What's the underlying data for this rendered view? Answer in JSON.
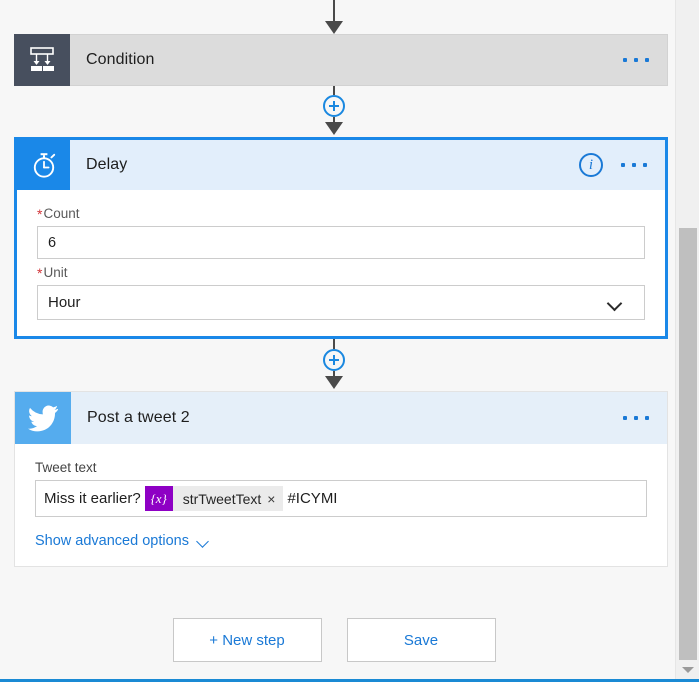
{
  "flow": {
    "condition_step": {
      "icon": "condition-branch-icon",
      "title": "Condition",
      "menu_label": "···"
    },
    "delay_step": {
      "icon": "stopwatch-icon",
      "title": "Delay",
      "info_label": "i",
      "menu_label": "···",
      "fields": {
        "count": {
          "label": "Count",
          "required_marker": "*",
          "value": "6"
        },
        "unit": {
          "label": "Unit",
          "required_marker": "*",
          "value": "Hour",
          "chevron": "chevron-down-icon"
        }
      }
    },
    "tweet_step": {
      "icon": "twitter-bird-icon",
      "title": "Post a tweet 2",
      "menu_label": "···",
      "fields": {
        "tweet_text": {
          "label": "Tweet text",
          "prefix_text": "Miss it earlier?",
          "token": {
            "badge": "{x}",
            "label": "strTweetText",
            "remove": "×"
          },
          "suffix_text": "#ICYMI"
        }
      },
      "advanced_options_label": "Show advanced options"
    },
    "add_step_label": "+"
  },
  "footer": {
    "new_step_label": "+ New step",
    "save_label": "Save"
  },
  "scrollbar": {
    "down_arrow": "scroll-down-arrow"
  },
  "colors": {
    "accent_blue": "#1a88e8",
    "link_blue": "#1a79d6",
    "condition_icon_bg": "#474f5e",
    "twitter_blue": "#55acee",
    "token_purple": "#8e00c4",
    "required_red": "#d13438"
  }
}
